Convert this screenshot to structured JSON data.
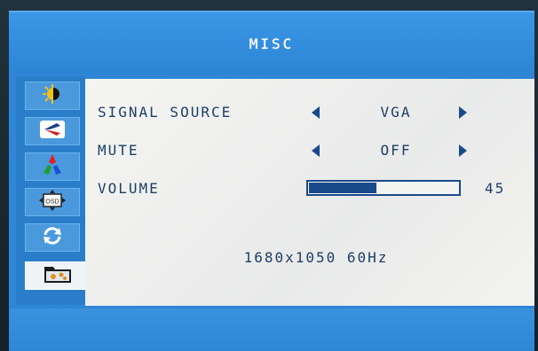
{
  "header": {
    "title": "MISC"
  },
  "sidebar": {
    "items": [
      {
        "icon": "brightness-contrast-icon"
      },
      {
        "icon": "image-setup-icon"
      },
      {
        "icon": "color-temp-icon"
      },
      {
        "icon": "osd-setup-icon",
        "label": "OSD"
      },
      {
        "icon": "reset-icon"
      },
      {
        "icon": "misc-icon"
      }
    ],
    "active_index": 5
  },
  "menu": {
    "signal_source": {
      "label": "SIGNAL SOURCE",
      "value": "VGA"
    },
    "mute": {
      "label": "MUTE",
      "value": "OFF"
    },
    "volume": {
      "label": "VOLUME",
      "value": "45",
      "level": 45
    }
  },
  "status": {
    "resolution": "1680x1050 60Hz"
  },
  "colors": {
    "osd_blue": "#2f86d6",
    "panel": "#f0f0ee",
    "text": "#1d3f66",
    "accent": "#1a4a8c"
  }
}
